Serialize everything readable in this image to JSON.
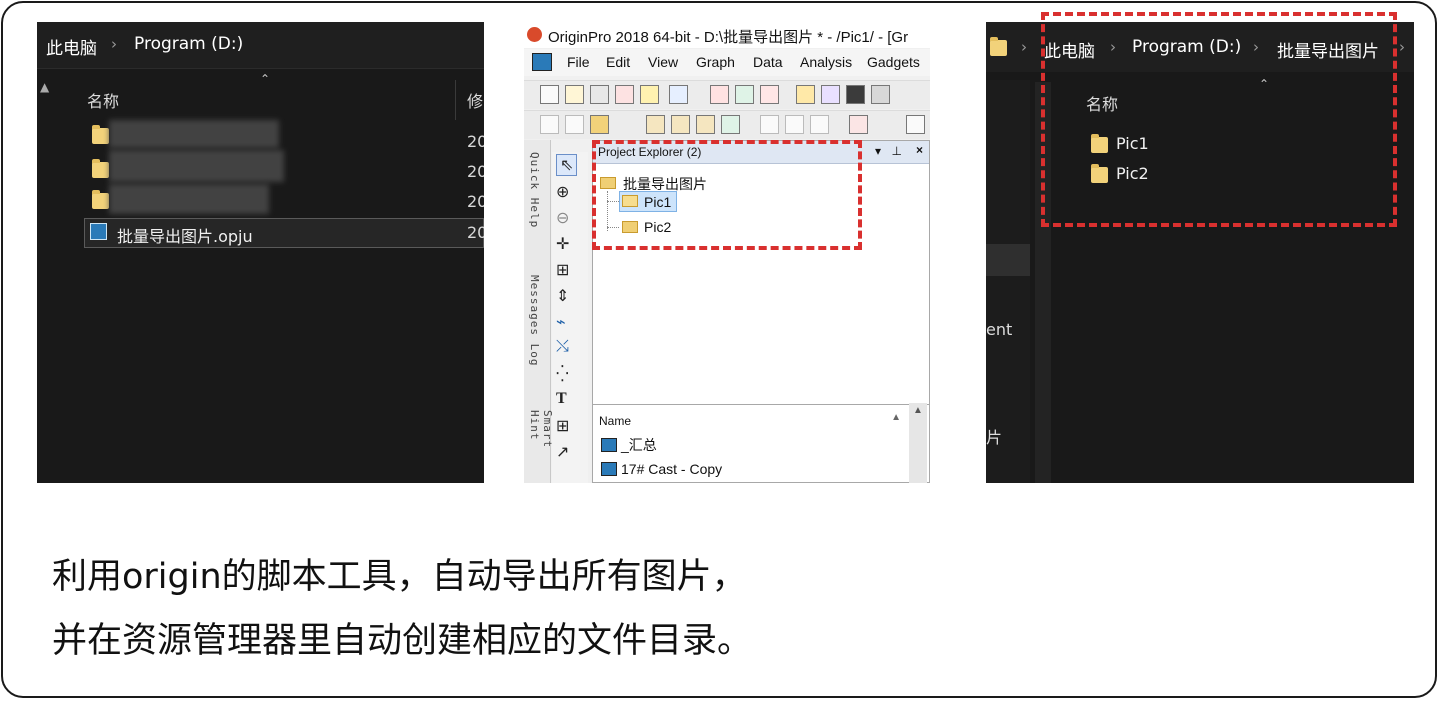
{
  "panel_explorer": {
    "breadcrumb": [
      "此电脑",
      "Program (D:)"
    ],
    "column_name": "名称",
    "column_modified": "修",
    "dates": [
      "20",
      "20",
      "20",
      "20"
    ],
    "selected_file": "批量导出图片.opju"
  },
  "panel_origin": {
    "window_title": "OriginPro 2018 64-bit - D:\\批量导出图片 * - /Pic1/ - [Gr",
    "menus": [
      "File",
      "Edit",
      "View",
      "Graph",
      "Data",
      "Analysis",
      "Gadgets"
    ],
    "side_tabs": [
      "Quick Help",
      "Messages Log",
      "Smart Hint"
    ],
    "project_explorer_title": "Project Explorer (2)",
    "tree": {
      "root": "批量导出图片",
      "children": [
        "Pic1",
        "Pic2"
      ]
    },
    "list_header": "Name",
    "list_items": [
      "_汇总",
      "17# Cast - Copy"
    ]
  },
  "panel_result": {
    "breadcrumb": [
      "此电脑",
      "Program (D:)",
      "批量导出图片"
    ],
    "column_name": "名称",
    "folders": [
      "Pic1",
      "Pic2"
    ],
    "side_fragments": [
      "ent",
      "片"
    ]
  },
  "caption": {
    "line1": "利用origin的脚本工具，自动导出所有图片，",
    "line2": "并在资源管理器里自动创建相应的文件目录。"
  },
  "colors": {
    "highlight_dash": "#d9302f",
    "dark_bg": "#191919"
  }
}
